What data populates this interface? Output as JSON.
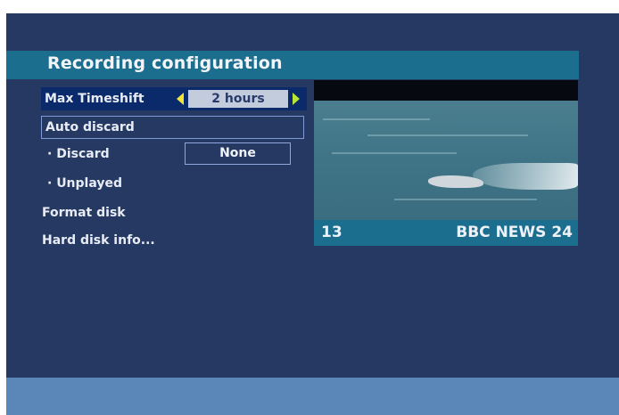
{
  "page": {
    "title": "Recording configuration"
  },
  "menu": {
    "items": [
      {
        "label": "Max Timeshift",
        "value": "2 hours"
      },
      {
        "label": "Auto discard"
      },
      {
        "label": "· Discard",
        "value": "None"
      },
      {
        "label": "· Unplayed"
      },
      {
        "label": "Format disk"
      },
      {
        "label": "Hard disk info..."
      }
    ]
  },
  "preview": {
    "channel_number": "13",
    "channel_name": "BBC NEWS 24"
  },
  "colors": {
    "background": "#253963",
    "title_bar": "#1c6e8e",
    "highlight": "#0a2a6b",
    "bottom_bar": "#5a87b8",
    "arrow_left": "#f0e53a",
    "arrow_right": "#b7e638"
  },
  "icons": {
    "left": "triangle-left-icon",
    "right": "triangle-right-icon"
  }
}
